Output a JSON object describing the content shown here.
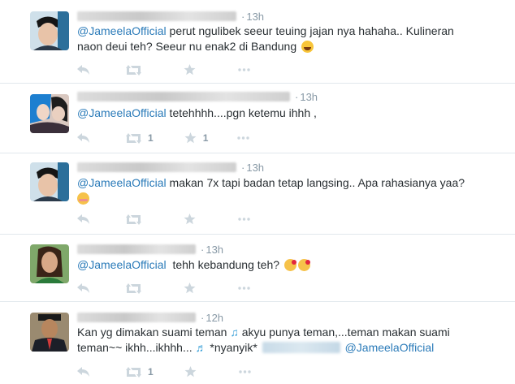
{
  "tweets": [
    {
      "time": "13h",
      "mention": "@JameelaOfficial",
      "line1": " perut ngulibek seeur teuing jajan nya hahaha.. Kulineran",
      "line2": "naon deui teh? Seeur nu enak2 di Bandung ",
      "emoji": "laughing-face",
      "retweet_count": "",
      "favorite_count": ""
    },
    {
      "time": "13h",
      "mention": "@JameelaOfficial",
      "line1": " tetehhhh....pgn ketemu ihhh ,",
      "retweet_count": "1",
      "favorite_count": "1"
    },
    {
      "time": "13h",
      "mention": "@JameelaOfficial",
      "line1": " makan 7x tapi badan tetap langsing.. Apa rahasianya yaa?",
      "emoji": "blushing-face",
      "retweet_count": "",
      "favorite_count": ""
    },
    {
      "time": "13h",
      "mention": "@JameelaOfficial",
      "line1": "  tehh kebandung teh? ",
      "emoji": "kissing-face",
      "retweet_count": "",
      "favorite_count": ""
    },
    {
      "time": "12h",
      "line1": "Kan yg dimakan suami teman ",
      "line1b": " akyu punya teman,...teman makan suami",
      "line2": "teman~~ ikhh...ikhhh... ",
      "line2b": " *nyanyik* ",
      "mention": "@JameelaOfficial",
      "retweet_count": "1",
      "favorite_count": ""
    }
  ],
  "glyphs": {
    "music_note": "♫",
    "music_notes": "♬",
    "dot": "·"
  },
  "colors": {
    "mention": "#2b7bb9",
    "meta": "#8899a6",
    "icon": "#ccd6dd",
    "divider": "#e1e8ed"
  }
}
